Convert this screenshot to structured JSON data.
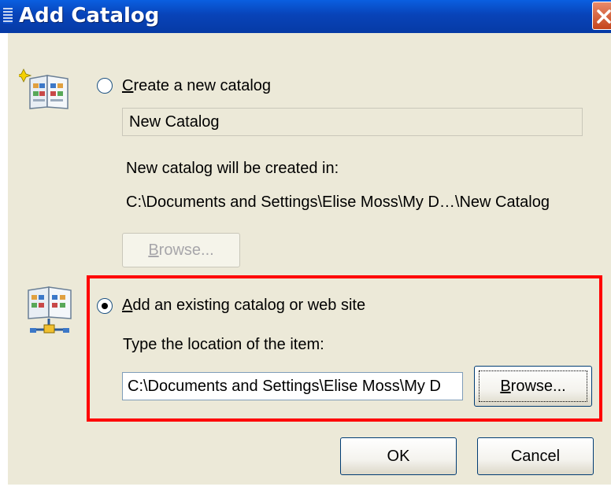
{
  "window": {
    "title": "Add Catalog"
  },
  "create_option": {
    "label_accel": "C",
    "label_rest": "reate a new catalog",
    "name_value": "New Catalog",
    "created_in_label": "New catalog will be created in:",
    "path": "C:\\Documents and Settings\\Elise Moss\\My D…\\New Catalog",
    "browse_accel": "B",
    "browse_rest": "rowse..."
  },
  "existing_option": {
    "label_accel": "A",
    "label_rest": "dd an existing catalog or web site",
    "location_label": "Type the location of the item:",
    "location_value": "C:\\Documents and Settings\\Elise Moss\\My D",
    "browse_accel": "B",
    "browse_rest": "rowse..."
  },
  "buttons": {
    "ok": "OK",
    "cancel": "Cancel"
  },
  "colors": {
    "title_bar": "#0843b8",
    "dialog_bg": "#ece9d8",
    "highlight": "#ff0000"
  },
  "icons": [
    "new-catalog-icon",
    "web-catalog-icon",
    "close-icon"
  ]
}
